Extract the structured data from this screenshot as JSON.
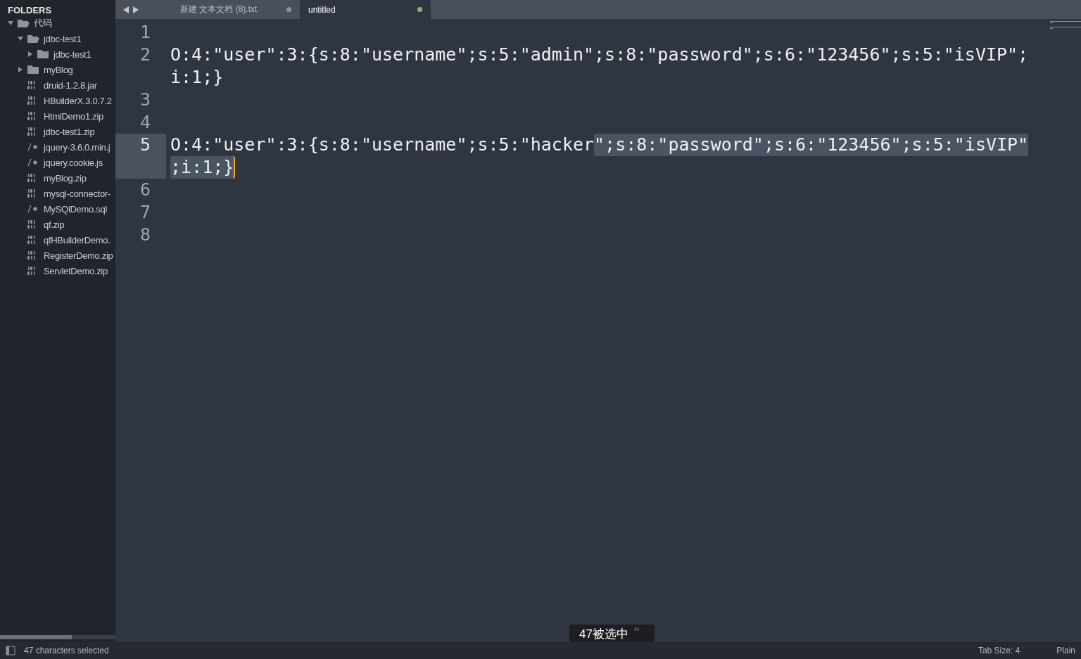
{
  "sidebar": {
    "title": "FOLDERS",
    "tree": [
      {
        "label": "代码",
        "kind": "folder",
        "expanded": true,
        "children": [
          {
            "label": "jdbc-test1",
            "kind": "folder",
            "expanded": true,
            "children": [
              {
                "label": "jdbc-test1",
                "kind": "folder",
                "expanded": false
              }
            ]
          },
          {
            "label": "myBlog",
            "kind": "folder",
            "expanded": false
          },
          {
            "label": "druid-1.2.8.jar",
            "kind": "binary"
          },
          {
            "label": "HBuilderX.3.0.7.2",
            "kind": "binary"
          },
          {
            "label": "HtmlDemo1.zip",
            "kind": "binary"
          },
          {
            "label": "jdbc-test1.zip",
            "kind": "binary"
          },
          {
            "label": "jquery-3.6.0.min.j",
            "kind": "code"
          },
          {
            "label": "jquery.cookie.js",
            "kind": "code"
          },
          {
            "label": "myBlog.zip",
            "kind": "binary"
          },
          {
            "label": "mysql-connector-",
            "kind": "binary"
          },
          {
            "label": "MySQlDemo.sql",
            "kind": "code"
          },
          {
            "label": "qf.zip",
            "kind": "binary"
          },
          {
            "label": "qfHBuilderDemo.",
            "kind": "binary"
          },
          {
            "label": "RegisterDemo.zip",
            "kind": "binary"
          },
          {
            "label": "ServletDemo.zip",
            "kind": "binary"
          }
        ]
      }
    ]
  },
  "tabs": [
    {
      "label": "新建 文本文档 (8).txt",
      "selected": false,
      "modified": true
    },
    {
      "label": "untitled",
      "selected": true,
      "modified": true
    }
  ],
  "editor": {
    "lines": [
      {
        "number": "1",
        "current": false
      },
      {
        "number": "2",
        "current": false,
        "rows": [
          [
            {
              "text": "O:4:\"user\":3:{s:8:\"username\";s:5:\"admin\";s:8:\"password\";s:6:\"123456\";s:5:\"isVIP\";",
              "selected": false
            }
          ],
          [
            {
              "text": "i:1;}",
              "selected": false
            }
          ]
        ]
      },
      {
        "number": "3",
        "current": false
      },
      {
        "number": "4",
        "current": false
      },
      {
        "number": "5",
        "current": true,
        "rows": [
          [
            {
              "text": "O:4:\"user\":3:{s:8:\"username\";s:5:\"hacker",
              "selected": false
            },
            {
              "text": "\";s:8:\"password\";s:6:\"123456\";s:5:\"isVIP\"",
              "selected": true
            }
          ],
          [
            {
              "text": ";i:1;}",
              "selected": true,
              "caret": true
            }
          ]
        ]
      },
      {
        "number": "6",
        "current": false
      },
      {
        "number": "7",
        "current": false
      },
      {
        "number": "8",
        "current": false
      }
    ]
  },
  "subtitle": {
    "text": "47被选中",
    "badge": "AI"
  },
  "status_bar": {
    "selection": "47 characters selected",
    "tab_size": "Tab Size: 4",
    "syntax": "Plain"
  }
}
